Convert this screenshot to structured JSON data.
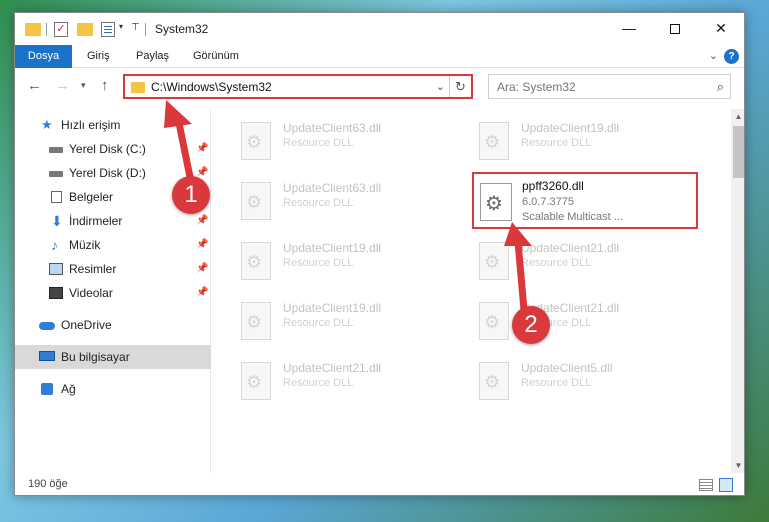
{
  "window": {
    "title": "System32",
    "controls": {
      "minimize": "—",
      "maximize": "",
      "close": "✕"
    }
  },
  "ribbon": {
    "tabs": [
      "Dosya",
      "Giriş",
      "Paylaş",
      "Görünüm"
    ],
    "help": "?"
  },
  "nav": {
    "address": "C:\\Windows\\System32",
    "search_placeholder": "Ara: System32"
  },
  "sidebar": {
    "items": [
      {
        "label": "Hızlı erişim",
        "icon": "star-icon",
        "pinned": false
      },
      {
        "label": "Yerel Disk (C:)",
        "icon": "drive-icon",
        "pinned": true
      },
      {
        "label": "Yerel Disk (D:)",
        "icon": "drive-icon",
        "pinned": true
      },
      {
        "label": "Belgeler",
        "icon": "document-icon",
        "pinned": true
      },
      {
        "label": "İndirmeler",
        "icon": "download-icon",
        "pinned": true
      },
      {
        "label": "Müzik",
        "icon": "music-icon",
        "pinned": true
      },
      {
        "label": "Resimler",
        "icon": "pictures-icon",
        "pinned": true
      },
      {
        "label": "Videolar",
        "icon": "video-icon",
        "pinned": true
      },
      {
        "label": "OneDrive",
        "icon": "cloud-icon",
        "pinned": false
      },
      {
        "label": "Bu bilgisayar",
        "icon": "computer-icon",
        "pinned": false,
        "active": true
      },
      {
        "label": "Ağ",
        "icon": "network-icon",
        "pinned": false
      }
    ]
  },
  "files": [
    {
      "name": "UpdateClient63.dll",
      "desc": "Resource DLL"
    },
    {
      "name": "UpdateClient19.dll",
      "desc": "Resource DLL"
    },
    {
      "name": "UpdateClient63.dll",
      "desc": "Resource DLL"
    },
    {
      "name": "UpdateClient19.dll",
      "desc": "Resource DLL"
    },
    {
      "name": "UpdateClient21.dll",
      "desc": "Resource DLL"
    },
    {
      "name": "UpdateClient19.dll",
      "desc": "Resource DLL"
    },
    {
      "name": "UpdateClient21.dll",
      "desc": "Resource DLL"
    },
    {
      "name": "UpdateClient21.dll",
      "desc": "Resource DLL"
    },
    {
      "name": "UpdateClient5.dll",
      "desc": "Resource DLL"
    }
  ],
  "highlighted_file": {
    "name": "ppff3260.dll",
    "version": "6.0.7.3775",
    "desc": "Scalable Multicast ..."
  },
  "status": {
    "count": "190 öğe"
  },
  "annotations": {
    "step1": "1",
    "step2": "2",
    "color": "#d9393a"
  }
}
